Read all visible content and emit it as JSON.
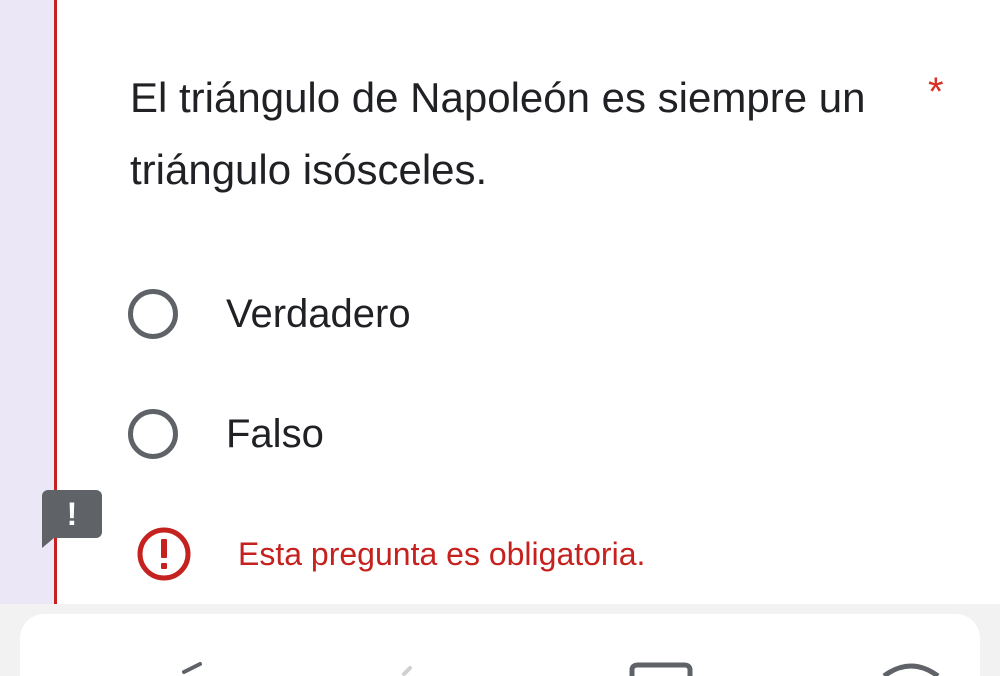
{
  "question": {
    "text": "El triángulo de Napoleón es siempre un triángulo isósceles.",
    "required_marker": "*"
  },
  "options": [
    {
      "label": "Verdadero",
      "selected": false
    },
    {
      "label": "Falso",
      "selected": false
    }
  ],
  "flag_badge": "!",
  "error": {
    "message": "Esta pregunta es obligatoria.",
    "icon": "error-icon"
  },
  "colors": {
    "error_red": "#c5221f",
    "radio_gray": "#5f6368",
    "text": "#202124",
    "side_background": "#ece7f6"
  },
  "nav_icons": [
    "back-icon",
    "home-icon",
    "recents-icon",
    "menu-icon"
  ]
}
